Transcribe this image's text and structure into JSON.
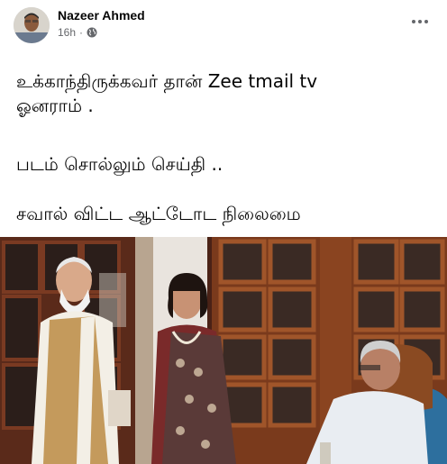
{
  "post": {
    "author": "Nazeer Ahmed",
    "timestamp": "16h",
    "separator": "·",
    "privacy_icon": "globe-icon",
    "more_icon": "more-horizontal-icon",
    "text_lines": [
      "உக்காந்திருக்கவர் தான் Zee tmail tv",
      "ஓனராம் .",
      "படம் சொல்லும் செய்தி ..",
      "சவால் விட்ட ஆட்டோட நிலைமை"
    ],
    "photo_subject": "post-photo"
  },
  "colors": {
    "text_primary": "#050505",
    "text_secondary": "#65676b",
    "background": "#ffffff"
  }
}
